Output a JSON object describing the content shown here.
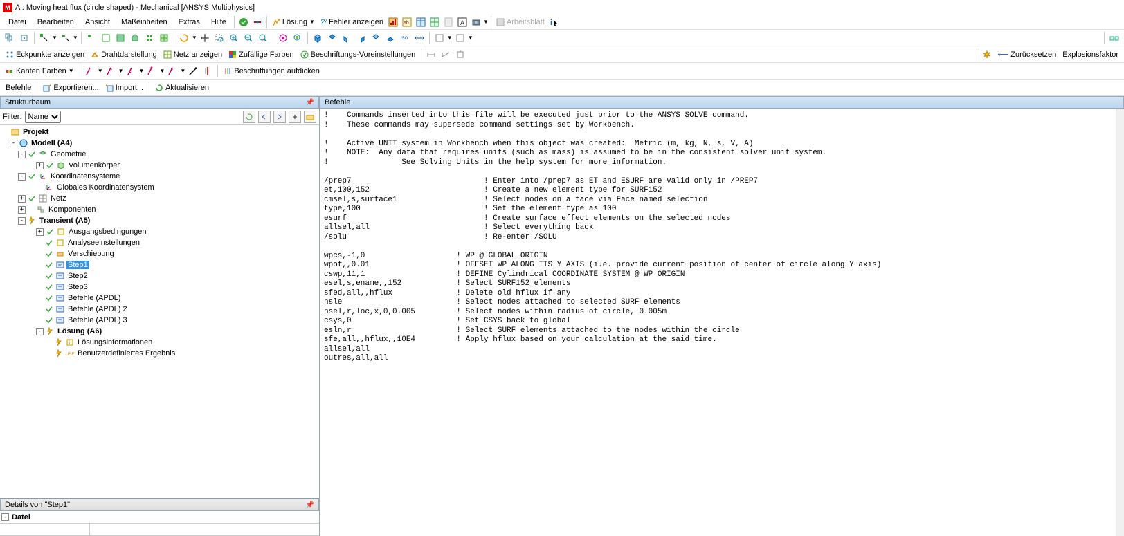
{
  "window": {
    "title": "A : Moving heat flux (circle shaped) - Mechanical [ANSYS Multiphysics]"
  },
  "menu": {
    "datei": "Datei",
    "bearbeiten": "Bearbeiten",
    "ansicht": "Ansicht",
    "masseinheiten": "Maßeinheiten",
    "extras": "Extras",
    "hilfe": "Hilfe",
    "losung": "Lösung",
    "fehler": "Fehler anzeigen",
    "arbeitsblatt": "Arbeitsblatt"
  },
  "toolbar2": {
    "eckpunkte": "Eckpunkte anzeigen",
    "draht": "Drahtdarstellung",
    "netz": "Netz anzeigen",
    "zufallige": "Zufällige Farben",
    "beschriftungs": "Beschriftungs-Voreinstellungen",
    "zuruck": "Zurücksetzen",
    "explosion": "Explosionsfaktor"
  },
  "toolbar3": {
    "kanten": "Kanten Farben",
    "beschr_auf": "Beschriftungen aufdicken"
  },
  "toolbar4": {
    "befehle": "Befehle",
    "export": "Exportieren...",
    "import": "Import...",
    "aktual": "Aktualisieren"
  },
  "tree_panel": {
    "title": "Strukturbaum",
    "filter_label": "Filter:",
    "filter_value": "Name"
  },
  "tree": {
    "projekt": "Projekt",
    "modell": "Modell (A4)",
    "geometrie": "Geometrie",
    "volumen": "Volumenkörper",
    "koord": "Koordinatensysteme",
    "globkoord": "Globales Koordinatensystem",
    "netz": "Netz",
    "kompon": "Komponenten",
    "transient": "Transient (A5)",
    "ausgangs": "Ausgangsbedingungen",
    "analyse": "Analyseeinstellungen",
    "verschieb": "Verschiebung",
    "step1": "Step1",
    "step2": "Step2",
    "step3": "Step3",
    "bapdl": "Befehle (APDL)",
    "bapdl2": "Befehle (APDL) 2",
    "bapdl3": "Befehle (APDL) 3",
    "losung": "Lösung (A6)",
    "losinfo": "Lösungsinformationen",
    "benutzer": "Benutzerdefiniertes Ergebnis"
  },
  "details": {
    "title": "Details von \"Step1\"",
    "row1": "Datei"
  },
  "right_panel": {
    "title": "Befehle"
  },
  "code": "!    Commands inserted into this file will be executed just prior to the ANSYS SOLVE command.\n!    These commands may supersede command settings set by Workbench.\n\n!    Active UNIT system in Workbench when this object was created:  Metric (m, kg, N, s, V, A)\n!    NOTE:  Any data that requires units (such as mass) is assumed to be in the consistent solver unit system.\n!                See Solving Units in the help system for more information.\n\n/prep7                             ! Enter into /prep7 as ET and ESURF are valid only in /PREP7\net,100,152                         ! Create a new element type for SURF152\ncmsel,s,surface1                   ! Select nodes on a face via Face named selection\ntype,100                           ! Set the element type as 100\nesurf                              ! Create surface effect elements on the selected nodes\nallsel,all                         ! Select everything back\n/solu                              ! Re-enter /SOLU\n\nwpcs,-1,0                    ! WP @ GLOBAL ORIGIN\nwpof,,0.01                   ! OFFSET WP ALONG ITS Y AXIS (i.e. provide current position of center of circle along Y axis)\ncswp,11,1                    ! DEFINE Cylindrical COORDINATE SYSTEM @ WP ORIGIN\nesel,s,ename,,152            ! Select SURF152 elements\nsfed,all,,hflux              ! Delete old hflux if any\nnsle                         ! Select nodes attached to selected SURF elements\nnsel,r,loc,x,0,0.005         ! Select nodes within radius of circle, 0.005m\ncsys,0                       ! Set CSYS back to global\nesln,r                       ! Select SURF elements attached to the nodes within the circle\nsfe,all,,hflux,,10E4         ! Apply hflux based on your calculation at the said time.\nallsel,all\noutres,all,all"
}
